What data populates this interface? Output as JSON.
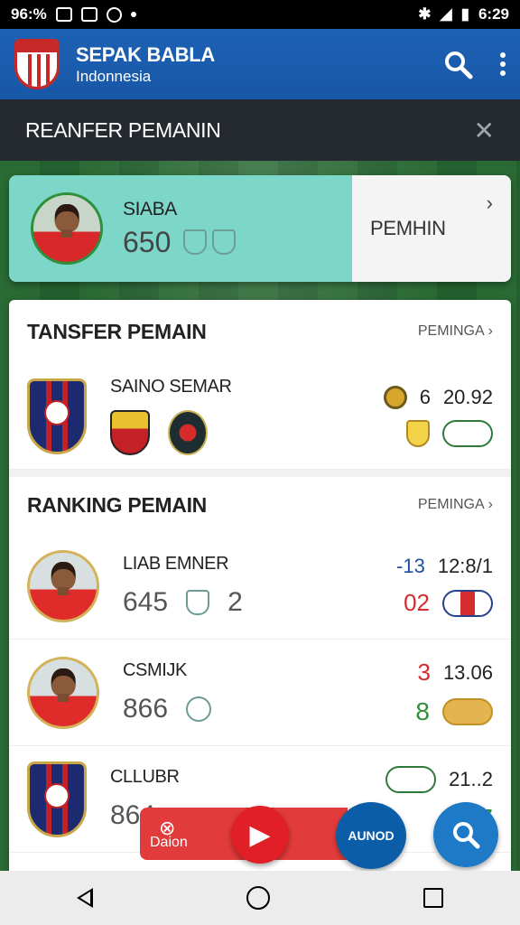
{
  "status_bar": {
    "left_text": "96:%",
    "time": "6:29"
  },
  "app_bar": {
    "title": "SEPAK BABLA",
    "subtitle": "Indonnesia"
  },
  "section_header": {
    "title": "REANFER PEMANIN"
  },
  "hero_card": {
    "name": "SIABA",
    "score": "650",
    "action_label": "PEMHIN"
  },
  "transfer_section": {
    "title": "TANSFER PEMAIN",
    "link_label": "PEMINGA",
    "rows": [
      {
        "name": "SAINO SEMAR",
        "coin_value": "6",
        "stat": "20.92"
      }
    ]
  },
  "ranking_section": {
    "title": "RANKING PEMAIN",
    "link_label": "PEMINGA",
    "rows": [
      {
        "name": "LIAB EMNER",
        "score": "645",
        "side_score": "2",
        "trend": "-13",
        "rank_value": "02",
        "stat": "12:8/1"
      },
      {
        "name": "CSMIJK",
        "score": "866",
        "side_score": "3",
        "trend": "",
        "rank_value": "8",
        "stat": "13.06"
      },
      {
        "name": "CLLUBR",
        "score": "864",
        "side_score": "",
        "trend": "",
        "rank_value": "17",
        "stat": "21..2"
      }
    ]
  },
  "fabs": {
    "left_label": "Daion",
    "brand_label": "AUNOD"
  },
  "colors": {
    "primary_blue": "#1d61b4",
    "header_dark": "#252a30",
    "accent_teal": "#7dd7c9",
    "accent_red": "#e01f26"
  }
}
